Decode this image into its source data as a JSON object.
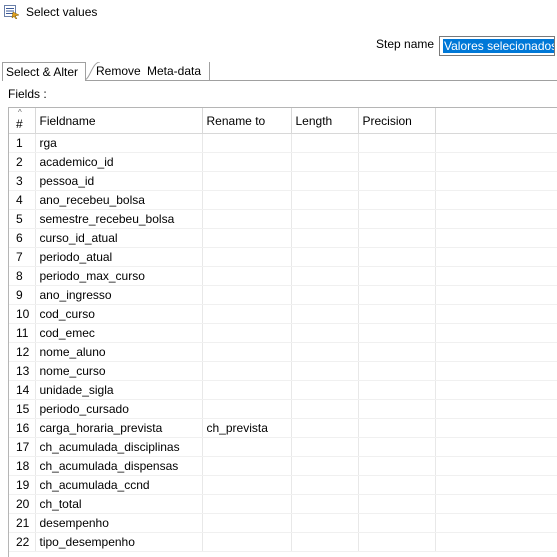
{
  "window": {
    "title": "Select values"
  },
  "step": {
    "label": "Step name",
    "value": "Valores selecionados"
  },
  "tabs": [
    {
      "label": "Select & Alter"
    },
    {
      "label": "Remove"
    },
    {
      "label": "Meta-data"
    }
  ],
  "fields_label": "Fields :",
  "table": {
    "columns": [
      "#",
      "Fieldname",
      "Rename to",
      "Length",
      "Precision"
    ],
    "rows": [
      {
        "num": "1",
        "fieldname": "rga",
        "rename": "",
        "length": "",
        "precision": ""
      },
      {
        "num": "2",
        "fieldname": "academico_id",
        "rename": "",
        "length": "",
        "precision": ""
      },
      {
        "num": "3",
        "fieldname": "pessoa_id",
        "rename": "",
        "length": "",
        "precision": ""
      },
      {
        "num": "4",
        "fieldname": "ano_recebeu_bolsa",
        "rename": "",
        "length": "",
        "precision": ""
      },
      {
        "num": "5",
        "fieldname": "semestre_recebeu_bolsa",
        "rename": "",
        "length": "",
        "precision": ""
      },
      {
        "num": "6",
        "fieldname": "curso_id_atual",
        "rename": "",
        "length": "",
        "precision": ""
      },
      {
        "num": "7",
        "fieldname": "periodo_atual",
        "rename": "",
        "length": "",
        "precision": ""
      },
      {
        "num": "8",
        "fieldname": "periodo_max_curso",
        "rename": "",
        "length": "",
        "precision": ""
      },
      {
        "num": "9",
        "fieldname": "ano_ingresso",
        "rename": "",
        "length": "",
        "precision": ""
      },
      {
        "num": "10",
        "fieldname": "cod_curso",
        "rename": "",
        "length": "",
        "precision": ""
      },
      {
        "num": "11",
        "fieldname": "cod_emec",
        "rename": "",
        "length": "",
        "precision": ""
      },
      {
        "num": "12",
        "fieldname": "nome_aluno",
        "rename": "",
        "length": "",
        "precision": ""
      },
      {
        "num": "13",
        "fieldname": "nome_curso",
        "rename": "",
        "length": "",
        "precision": ""
      },
      {
        "num": "14",
        "fieldname": "unidade_sigla",
        "rename": "",
        "length": "",
        "precision": ""
      },
      {
        "num": "15",
        "fieldname": "periodo_cursado",
        "rename": "",
        "length": "",
        "precision": ""
      },
      {
        "num": "16",
        "fieldname": "carga_horaria_prevista",
        "rename": "ch_prevista",
        "length": "",
        "precision": ""
      },
      {
        "num": "17",
        "fieldname": "ch_acumulada_disciplinas",
        "rename": "",
        "length": "",
        "precision": ""
      },
      {
        "num": "18",
        "fieldname": "ch_acumulada_dispensas",
        "rename": "",
        "length": "",
        "precision": ""
      },
      {
        "num": "19",
        "fieldname": "ch_acumulada_ccnd",
        "rename": "",
        "length": "",
        "precision": ""
      },
      {
        "num": "20",
        "fieldname": "ch_total",
        "rename": "",
        "length": "",
        "precision": ""
      },
      {
        "num": "21",
        "fieldname": "desempenho",
        "rename": "",
        "length": "",
        "precision": ""
      },
      {
        "num": "22",
        "fieldname": "tipo_desempenho",
        "rename": "",
        "length": "",
        "precision": ""
      }
    ]
  },
  "icons": {
    "app": "select-values-step-icon",
    "sort": "sort-ascending-icon"
  },
  "colors": {
    "selection": "#0078d7",
    "border": "#a0a0a0"
  }
}
